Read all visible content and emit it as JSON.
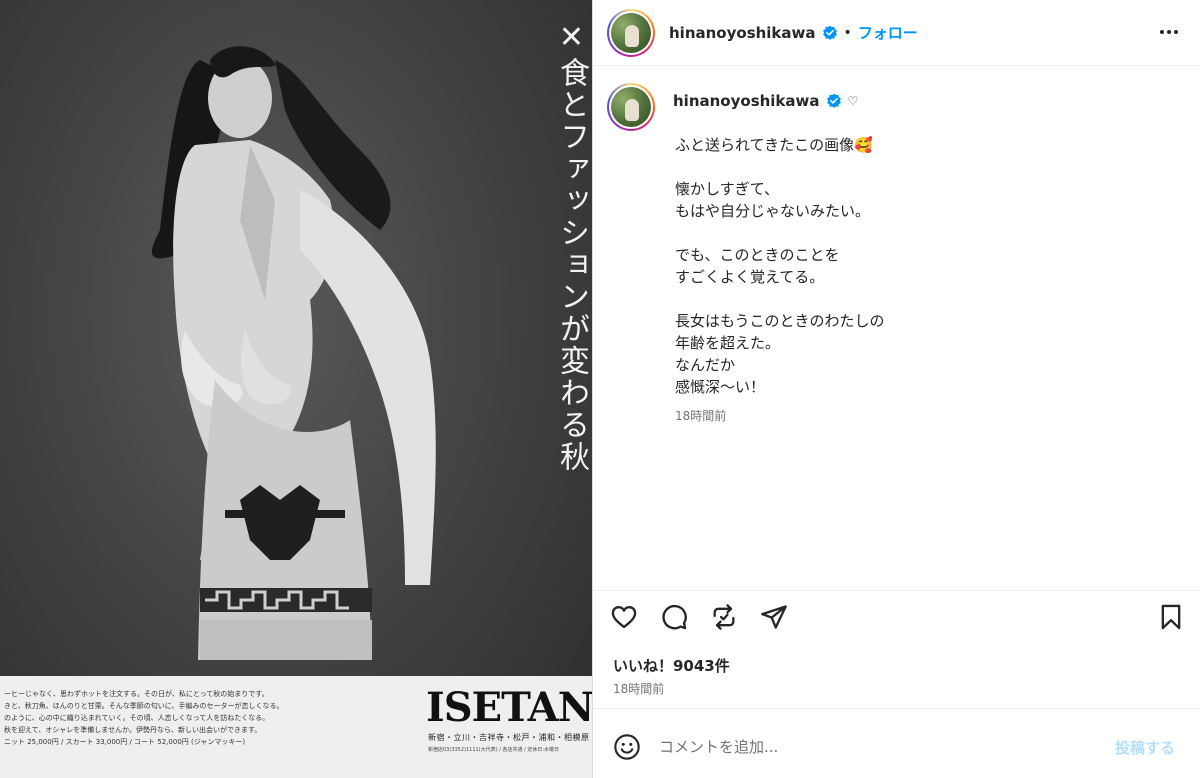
{
  "post_image": {
    "vertical_headline": "食とファッションが変わる秋",
    "cross_mark": "✕",
    "brand": "ISETAN",
    "brand_stores": "新宿・立川・吉祥寺・松戸・浦和・相模原",
    "brand_small": "新宿店03(3352)1111(大代表) / 各店共通 / 定休日:水曜日",
    "body_copy": [
      "ーヒーじゃなく、思わずホットを注文する。その日が、私にとって秋の始まりです。",
      "きと、秋刀魚、ほんのりと甘栗。そんな季節の匂いに、手編みのセーターが恋しくなる。",
      "のように、心の中に織り込まれていく。その頃、人恋しくなって人を訪ねたくなる。",
      "秋を迎えて、オシャレを準備しませんか。伊勢丹なら、新しい出会いができます。",
      "ニット 25,000円 / スカート 33,000円 / コート 52,000円 (ジャンマッキー)"
    ]
  },
  "header": {
    "username": "hinanoyoshikawa",
    "dot": "•",
    "follow_label": "フォロー"
  },
  "caption": {
    "username": "hinanoyoshikawa",
    "heart": "♡",
    "lines": [
      "ふと送られてきたこの画像🥰",
      "",
      "懐かしすぎて、",
      "もはや自分じゃないみたい。",
      "",
      "でも、このときのことを",
      "すごくよく覚えてる。",
      "",
      "長女はもうこのときのわたしの",
      "年齢を超えた。",
      "なんだか",
      "感慨深〜い！"
    ],
    "time": "18時間前"
  },
  "actions": {
    "like_icon": "heart-icon",
    "comment_icon": "comment-icon",
    "share_icon": "repost-icon",
    "send_icon": "send-icon",
    "save_icon": "bookmark-icon"
  },
  "likes": "いいね！9043件",
  "post_time": "18時間前",
  "comment": {
    "placeholder": "コメントを追加...",
    "post_label": "投稿する"
  },
  "colors": {
    "accent": "#0095f6",
    "post_disabled": "#b2dffc",
    "verified": "#0095f6"
  }
}
